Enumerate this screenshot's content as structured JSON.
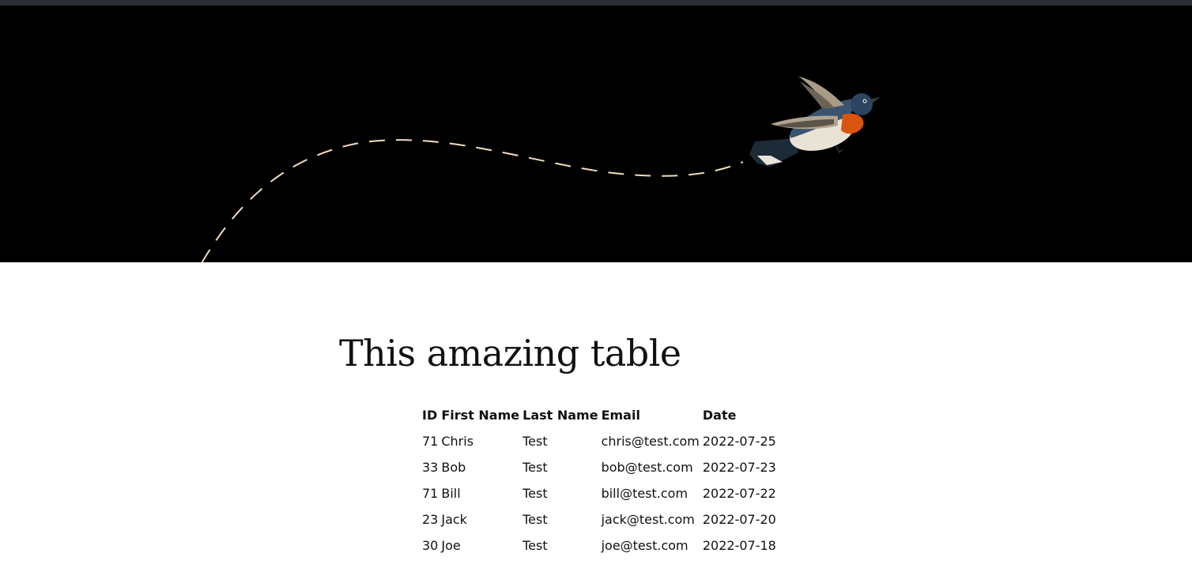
{
  "page": {
    "title": "This amazing table"
  },
  "table": {
    "columns": [
      "ID",
      "First Name",
      "Last Name",
      "Email",
      "Date"
    ],
    "rows": [
      {
        "id": "71",
        "first_name": "Chris",
        "last_name": "Test",
        "email": "chris@test.com",
        "date": "2022-07-25"
      },
      {
        "id": "33",
        "first_name": "Bob",
        "last_name": "Test",
        "email": "bob@test.com",
        "date": "2022-07-23"
      },
      {
        "id": "71",
        "first_name": "Bill",
        "last_name": "Test",
        "email": "bill@test.com",
        "date": "2022-07-22"
      },
      {
        "id": "23",
        "first_name": "Jack",
        "last_name": "Test",
        "email": "jack@test.com",
        "date": "2022-07-20"
      },
      {
        "id": "30",
        "first_name": "Joe",
        "last_name": "Test",
        "email": "joe@test.com",
        "date": "2022-07-18"
      }
    ]
  },
  "colors": {
    "hero_background": "#000000",
    "flight_path": "#f3dcc0",
    "topbar": "#2b2f33"
  },
  "icons": {
    "hero_illustration": "bird-icon"
  }
}
